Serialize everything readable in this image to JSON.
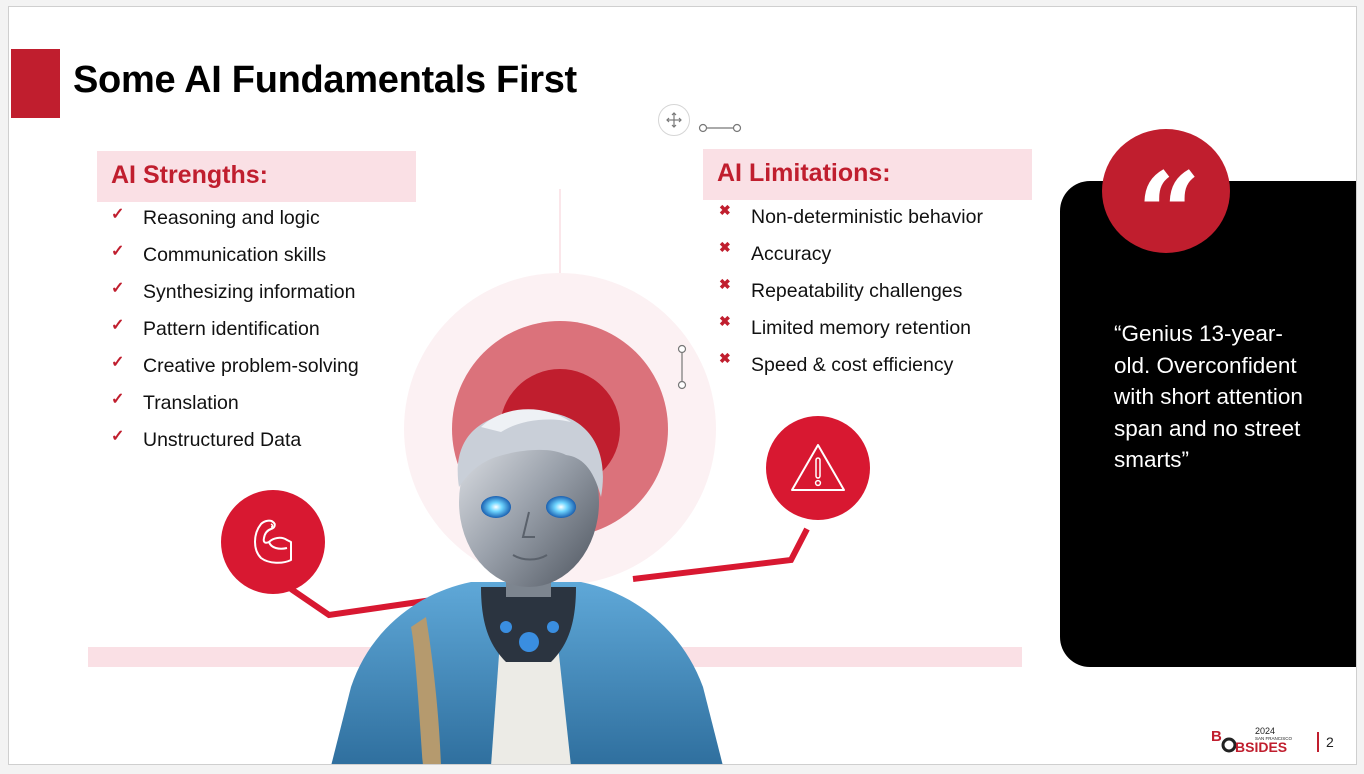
{
  "slide": {
    "title": "Some AI Fundamentals First",
    "page_number": "2",
    "colors": {
      "accent_red": "#c01e2e",
      "icon_red": "#d81831",
      "light_pink": "#fae0e5",
      "salmon": "#db727b",
      "quote_bg": "#000000"
    }
  },
  "editor": {
    "move_handle_icon": "move-arrows-icon",
    "connector_handle_icon": "connector-handle-icon"
  },
  "strengths": {
    "heading": "AI Strengths:",
    "marker_icon": "checkmark-icon",
    "marker": "✓",
    "items": [
      "Reasoning and logic",
      "Communication skills",
      "Synthesizing information",
      "Pattern identification",
      "Creative problem-solving",
      "Translation",
      "Unstructured Data"
    ]
  },
  "limitations": {
    "heading": "AI Limitations:",
    "marker_icon": "cross-icon",
    "marker": "✖",
    "items": [
      "Non-deterministic behavior",
      "Accuracy",
      "Repeatability challenges",
      "Limited memory retention",
      "Speed & cost efficiency"
    ]
  },
  "icons": {
    "strength": "flexed-bicep-icon",
    "limitation": "warning-triangle-icon"
  },
  "illustration": {
    "subject": "robot teen in blue hoodie"
  },
  "quote": {
    "glyph": "“",
    "text": "“Genius 13-year-old. Overconfident with short attention span and no street smarts”"
  },
  "footer": {
    "logo_main": "BSIDES",
    "logo_year": "2024",
    "logo_city": "SAN FRANCISCO"
  }
}
